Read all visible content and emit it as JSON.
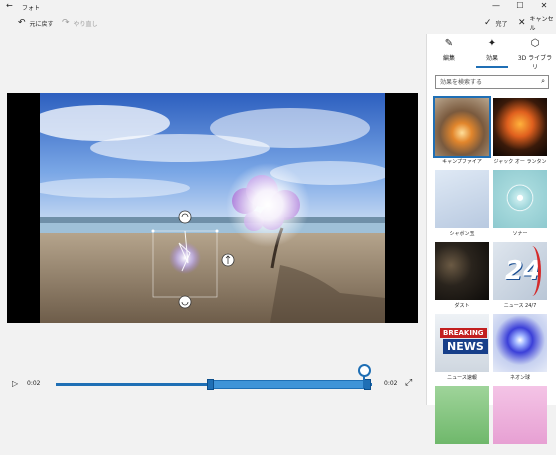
{
  "app": {
    "title": "フォト"
  },
  "window_buttons": [
    "—",
    "☐",
    "✕"
  ],
  "toolbar": {
    "undo_label": "元に戻す",
    "redo_label": "やり直し",
    "done_label": "完了",
    "cancel_label": "キャンセル"
  },
  "timeline": {
    "current_time": "0:02",
    "end_time": "0:02",
    "playhead_progress": 0.97,
    "selection_start": 0.49,
    "selection_end": 1.0
  },
  "panel": {
    "tabs": [
      {
        "label": "編集",
        "icon": "pencil-icon"
      },
      {
        "label": "効果",
        "icon": "effects-icon"
      },
      {
        "label": "3D ライブラリ",
        "icon": "cube-icon"
      }
    ],
    "active_tab": 1,
    "search_placeholder": "効果を検索する",
    "effects": [
      {
        "label": "キャンプファイア",
        "selected": true
      },
      {
        "label": "ジャック オー ランタン"
      },
      {
        "label": "シャボン玉"
      },
      {
        "label": "ソナー"
      },
      {
        "label": "ダスト"
      },
      {
        "label": "ニュース 24/7"
      },
      {
        "label": "ニュース速報"
      },
      {
        "label": "ネオン球"
      }
    ],
    "thumb_texts": {
      "news247": "24",
      "breaking1": "BREAKING",
      "breaking2": "NEWS"
    }
  },
  "colors": {
    "accent": "#1f6fb5"
  }
}
